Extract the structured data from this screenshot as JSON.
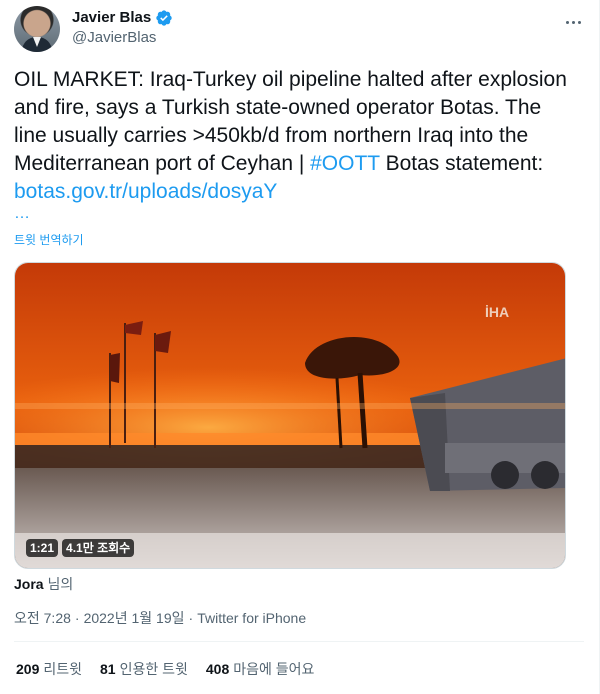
{
  "author": {
    "display_name": "Javier Blas",
    "handle": "@JavierBlas"
  },
  "tweet": {
    "text_main": "OIL MARKET: Iraq-Turkey oil pipeline halted after explosion and fire, says a Turkish state-owned operator Botas. The line usually carries >450kb/d from northern Iraq into the Mediterranean port of Ceyhan | ",
    "hashtag": "#OOTT",
    "text_after_hashtag": " Botas statement: ",
    "link": "botas.gov.tr/uploads/dosyaY",
    "ellipsis": "…",
    "translate_label": "트윗 번역하기"
  },
  "media": {
    "watermark": "İHA",
    "duration": "1:21",
    "views": "4.1만 조회수"
  },
  "attribution": {
    "name": "Jora",
    "suffix": " 님의"
  },
  "meta": {
    "time": "오전 7:28",
    "date": "2022년 1월 19일",
    "source": "Twitter for iPhone",
    "separator": "·"
  },
  "stats": [
    {
      "count": "209",
      "label": "리트윗"
    },
    {
      "count": "81",
      "label": "인용한 트윗"
    },
    {
      "count": "408",
      "label": "마음에 들어요"
    }
  ],
  "colors": {
    "accent": "#1d9bf0",
    "text": "#0f1419",
    "secondary": "#536471"
  }
}
